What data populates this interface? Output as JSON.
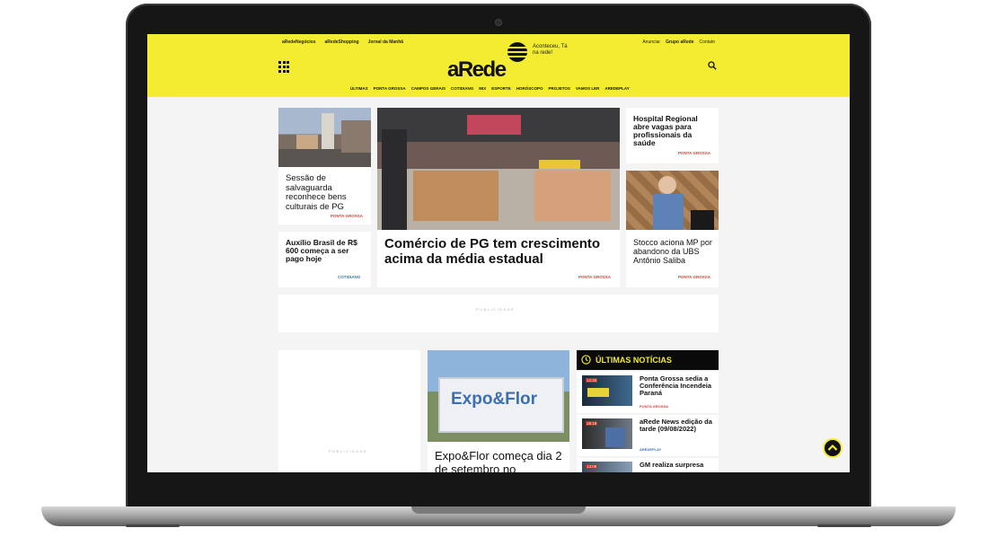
{
  "header": {
    "top_links": [
      "aRedeNegócios",
      "aRedeShopping",
      "Jornal da Manhã"
    ],
    "right_links": [
      "Anunciar",
      "Grupo aRede",
      "Contato"
    ],
    "logo": "aRede",
    "slogan": "Aconteceu, Tá na rede!",
    "nav": [
      "ÚLTIMAS",
      "PONTA GROSSA",
      "CAMPOS GERAIS",
      "COTIDIANO",
      "MIX",
      "ESPORTE",
      "HORÓSCOPO",
      "PROJETOS",
      "VAMOS LER",
      "AREDEPLAY"
    ]
  },
  "cards": {
    "sessao": {
      "title": "Sessão de salvaguarda reconhece bens culturais de PG",
      "tag": "PONTA GROSSA"
    },
    "auxilio": {
      "title": "Auxílio Brasil de R$ 600 começa a ser pago hoje",
      "tag": "COTIDIANO"
    },
    "comercio": {
      "title": "Comércio de PG tem crescimento acima da média estadual",
      "tag": "PONTA GROSSA"
    },
    "hospital": {
      "title": "Hospital Regional abre vagas para profissionais da saúde",
      "tag": "PONTA GROSSA"
    },
    "stocco": {
      "title": "Stocco aciona MP por abandono da UBS Antônio Saliba",
      "tag": "PONTA GROSSA"
    },
    "expo": {
      "title": "Expo&Flor começa dia 2 de setembro no",
      "banner": "Expo&Flor"
    }
  },
  "ads": {
    "label": "PUBLICIDADE"
  },
  "latest": {
    "title": "ÚLTIMAS NOTÍCIAS",
    "items": [
      {
        "title": "Ponta Grossa sedia a Conferência Incendeia Paraná",
        "tag": "PONTA GROSSA",
        "time": "14:33"
      },
      {
        "title": "aRede News edição da tarde (09/08/2022)",
        "tag": "AREDEPLAY",
        "time": "18:19"
      },
      {
        "title": "GM realiza surpresa",
        "tag": "",
        "time": "13:08"
      }
    ]
  },
  "colors": {
    "brand_yellow": "#f3ec31",
    "tag_red": "#e23b3b",
    "tag_blue": "#3a73c6"
  }
}
